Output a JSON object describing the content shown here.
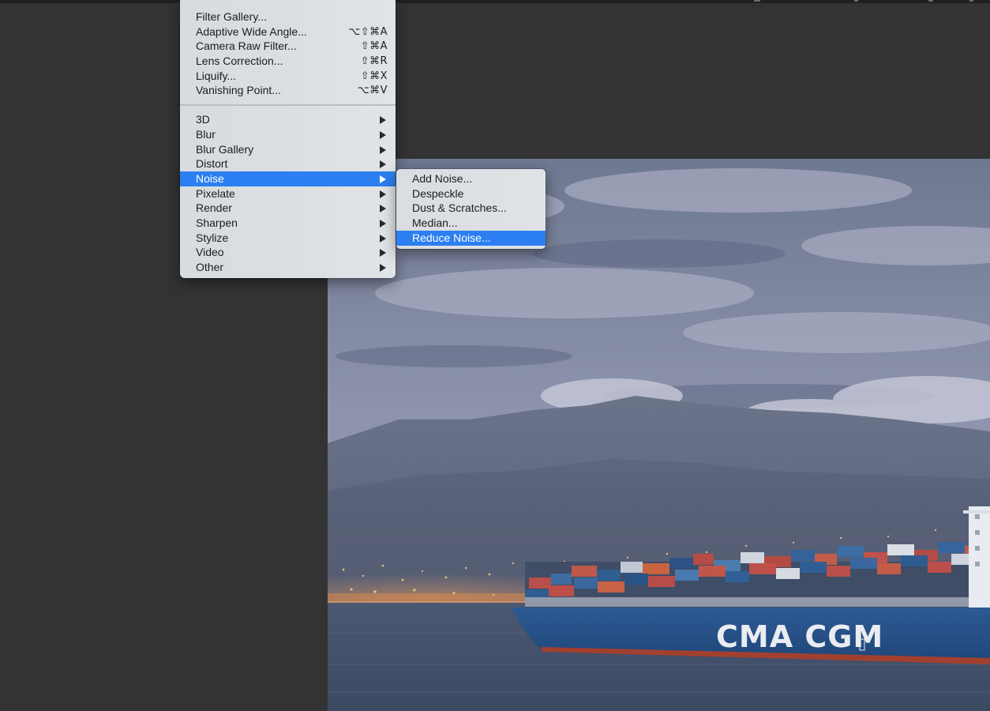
{
  "filter_menu": {
    "top_items": [
      {
        "label": "Filter Gallery...",
        "shortcut": ""
      },
      {
        "label": "Adaptive Wide Angle...",
        "shortcut": "⌥⇧⌘A"
      },
      {
        "label": "Camera Raw Filter...",
        "shortcut": "⇧⌘A"
      },
      {
        "label": "Lens Correction...",
        "shortcut": "⇧⌘R"
      },
      {
        "label": "Liquify...",
        "shortcut": "⇧⌘X"
      },
      {
        "label": "Vanishing Point...",
        "shortcut": "⌥⌘V"
      }
    ],
    "submenus": [
      {
        "label": "3D"
      },
      {
        "label": "Blur"
      },
      {
        "label": "Blur Gallery"
      },
      {
        "label": "Distort"
      },
      {
        "label": "Noise",
        "highlighted": true
      },
      {
        "label": "Pixelate"
      },
      {
        "label": "Render"
      },
      {
        "label": "Sharpen"
      },
      {
        "label": "Stylize"
      },
      {
        "label": "Video"
      },
      {
        "label": "Other"
      }
    ]
  },
  "noise_submenu": {
    "items": [
      {
        "label": "Add Noise..."
      },
      {
        "label": "Despeckle"
      },
      {
        "label": "Dust & Scratches..."
      },
      {
        "label": "Median..."
      },
      {
        "label": "Reduce Noise...",
        "highlighted": true
      }
    ]
  },
  "canvas": {
    "ship_hull_text": "CMA CGM"
  },
  "colors": {
    "highlight": "#2c7ff0",
    "menu_bg": "#dadee2",
    "workspace_bg": "#333333"
  },
  "icons": {
    "submenu_arrow": "triangle-right-icon"
  }
}
